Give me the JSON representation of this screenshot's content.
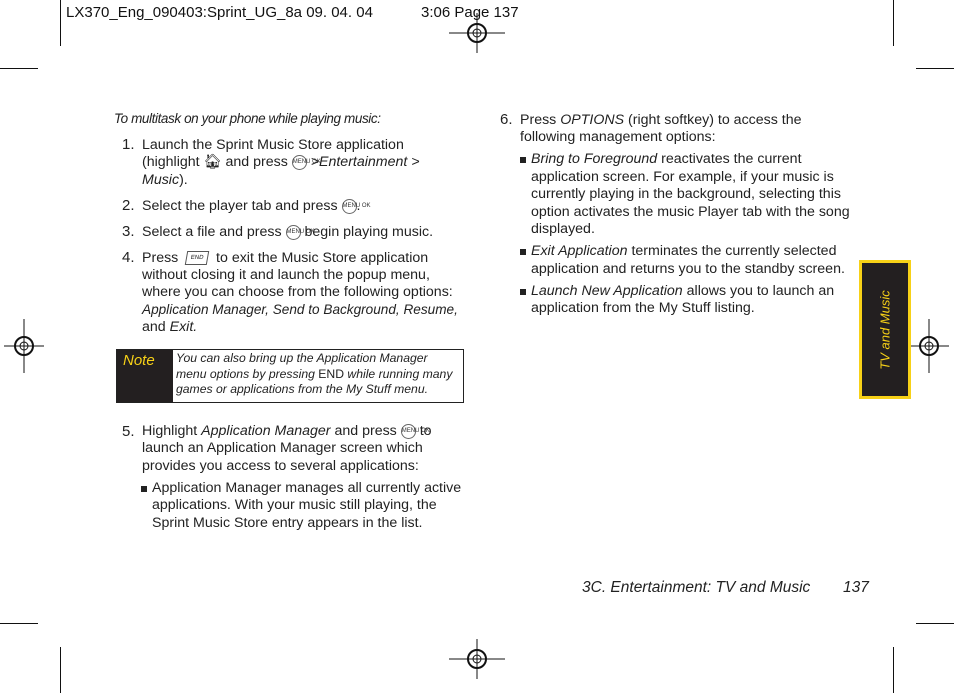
{
  "header": {
    "slug": "LX370_Eng_090403:Sprint_UG_8a  09. 04. 04",
    "time_page": "3:06  Page 137"
  },
  "left": {
    "intro": "To multitask on your phone while playing music:",
    "steps": [
      {
        "num": "1.",
        "lines": [
          "Launch the Sprint Music Store application",
          "(highlight",
          "and press",
          ">Entertainment >",
          "Music",
          ")."
        ]
      },
      {
        "num": "2.",
        "lines": [
          "Select the player tab and press",
          "."
        ]
      },
      {
        "num": "3.",
        "lines": [
          "Select a file and press",
          "begin playing music."
        ]
      },
      {
        "num": "4.",
        "lines": [
          "Press",
          "to exit the Music Store application",
          "without closing it and launch the popup menu,",
          "where you can choose from the following options:",
          "Application Manager, Send to Background, Resume,",
          "and",
          "Exit."
        ]
      },
      {
        "num": "5.",
        "lines": [
          "Highlight",
          "Application Manager",
          "and press",
          "to",
          "launch an Application Manager screen which",
          "provides you access to several applications:"
        ]
      }
    ],
    "note": {
      "label": "Note",
      "lines": [
        "You can also bring up the Application Manager",
        "menu options by pressing",
        "END",
        "while running many",
        "games or applications from the My Stuff menu."
      ]
    },
    "bullet": [
      "Application Manager manages all currently active",
      "applications. With your music still playing, the",
      "Sprint Music Store entry appears in the list."
    ],
    "keys": {
      "ok": "MENU OK",
      "end": "END"
    }
  },
  "right": {
    "step6": {
      "num": "6.",
      "lines": [
        "Press",
        "OPTIONS",
        "(right softkey) to access the",
        "following management options:"
      ]
    },
    "bullets": [
      {
        "term": "Bring to Foreground",
        "lines": [
          "reactivates the current",
          "application screen. For example, if your music is",
          "currently playing in the background, selecting this",
          "option activates the music Player tab with the song",
          "displayed."
        ]
      },
      {
        "term": "Exit Application",
        "lines": [
          "terminates the currently selected",
          "application and returns you to the standby screen."
        ]
      },
      {
        "term": "Launch New Application",
        "lines": [
          "allows you to launch an",
          "application from the My Stuff listing."
        ]
      }
    ]
  },
  "side_tab": "TV and Music",
  "footer": {
    "section": "3C. Entertainment: TV and Music",
    "page": "137"
  },
  "colors": {
    "accent": "#f7d117",
    "dark": "#231f20"
  }
}
